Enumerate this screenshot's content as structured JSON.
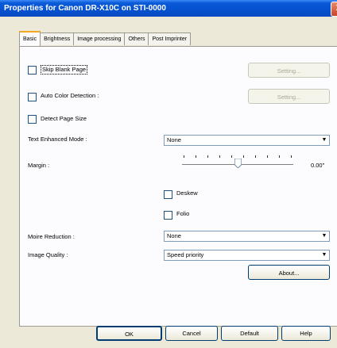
{
  "window": {
    "title": "Properties for Canon DR-X10C on STI-0000",
    "close_label": "X"
  },
  "tabs": [
    {
      "label": "Basic"
    },
    {
      "label": "Brightness"
    },
    {
      "label": "Image processing"
    },
    {
      "label": "Others"
    },
    {
      "label": "Post Imprinter"
    }
  ],
  "basic": {
    "skip_blank_page": {
      "label": "Skip Blank Page",
      "checked": false,
      "setting_label": "Setting..."
    },
    "auto_color_detection": {
      "label": "Auto Color Detection :",
      "checked": false,
      "setting_label": "Setting..."
    },
    "detect_page_size": {
      "label": "Detect Page Size",
      "checked": false
    },
    "text_enhanced_mode": {
      "label": "Text Enhanced Mode :",
      "value": "None"
    },
    "margin": {
      "label": "Margin :",
      "value": "0.00\""
    },
    "deskew": {
      "label": "Deskew",
      "checked": false
    },
    "folio": {
      "label": "Folio",
      "checked": false
    },
    "moire_reduction": {
      "label": "Moire Reduction :",
      "value": "None"
    },
    "image_quality": {
      "label": "Image Quality :",
      "value": "Speed priority"
    },
    "about_label": "About..."
  },
  "footer": {
    "ok": "OK",
    "cancel": "Cancel",
    "default": "Default",
    "help": "Help"
  }
}
